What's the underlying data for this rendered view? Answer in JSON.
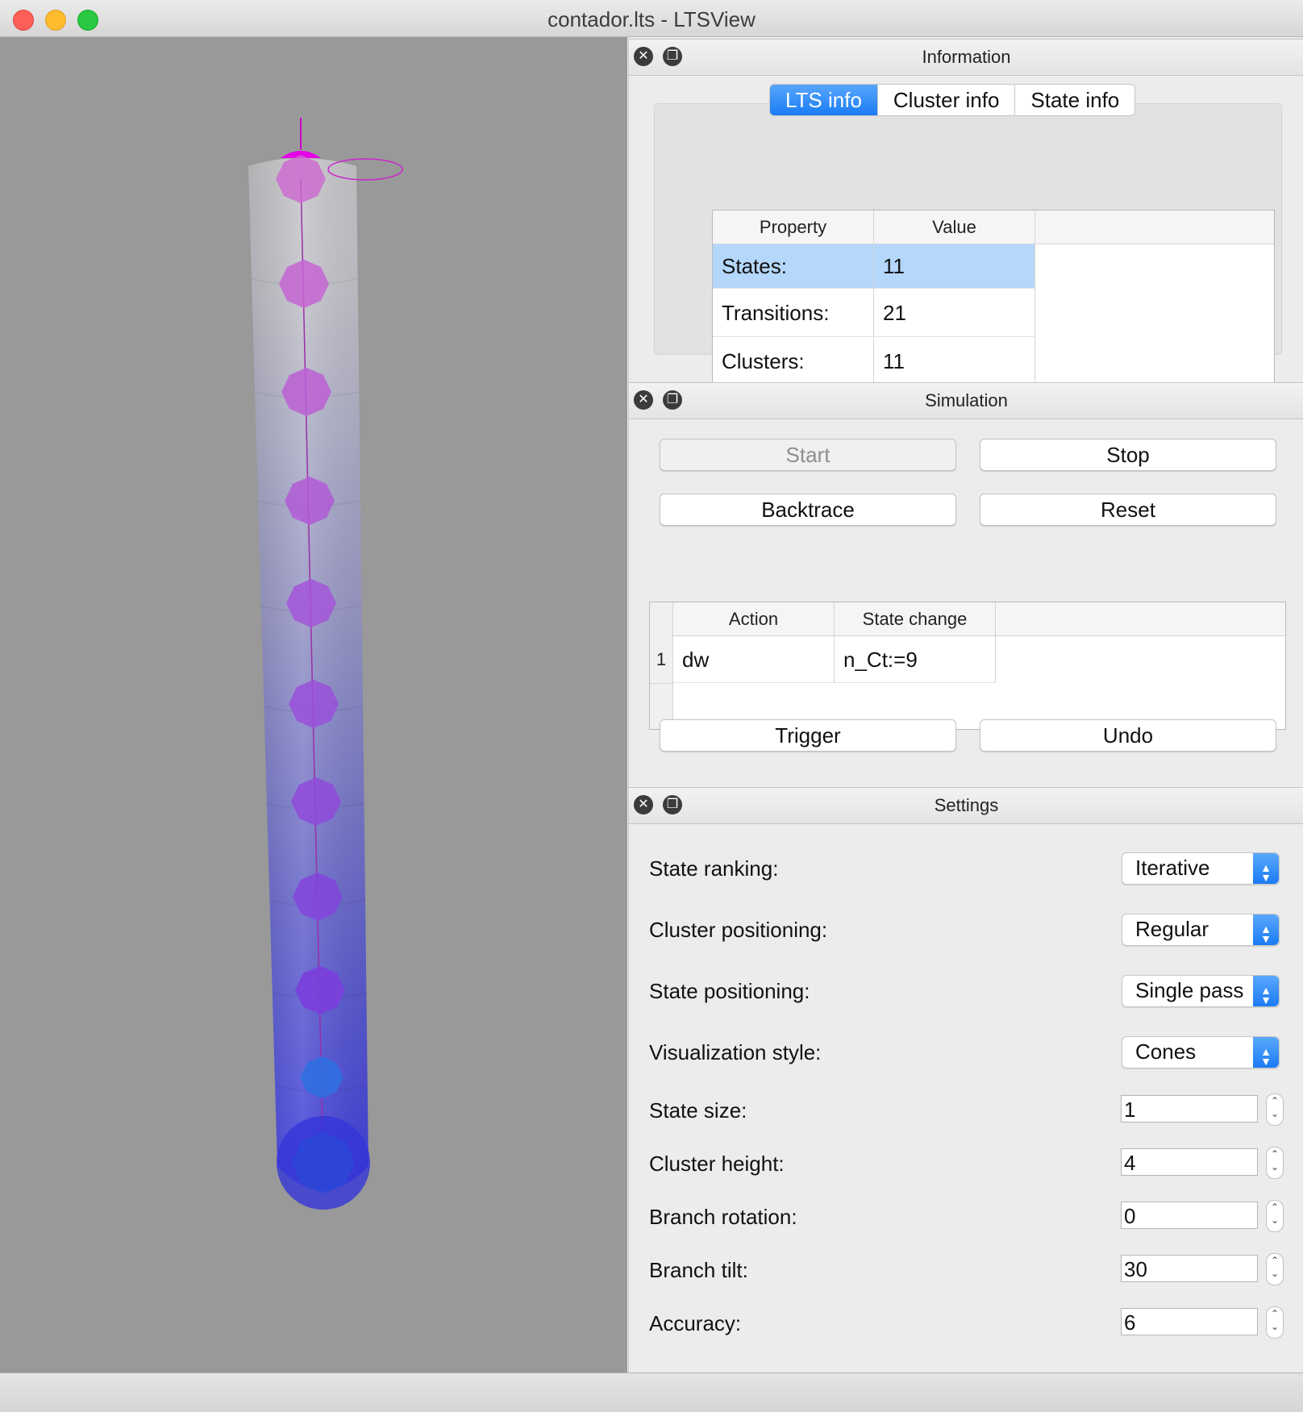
{
  "window": {
    "title": "contador.lts - LTSView"
  },
  "information": {
    "title": "Information",
    "tabs": [
      {
        "label": "LTS info",
        "active": true
      },
      {
        "label": "Cluster info",
        "active": false
      },
      {
        "label": "State info",
        "active": false
      }
    ],
    "table": {
      "headers": [
        "Property",
        "Value"
      ],
      "rows": [
        {
          "property": "States:",
          "value": "11",
          "selected": true
        },
        {
          "property": "Transitions:",
          "value": "21",
          "selected": false
        },
        {
          "property": "Clusters:",
          "value": "11",
          "selected": false
        }
      ]
    }
  },
  "simulation": {
    "title": "Simulation",
    "buttons": {
      "start": "Start",
      "stop": "Stop",
      "backtrace": "Backtrace",
      "reset": "Reset",
      "trigger": "Trigger",
      "undo": "Undo"
    },
    "table": {
      "headers": [
        "Action",
        "State change"
      ],
      "rows": [
        {
          "num": "1",
          "action": "dw",
          "state_change": "n_Ct:=9"
        }
      ]
    }
  },
  "settings": {
    "title": "Settings",
    "state_ranking": {
      "label": "State ranking:",
      "value": "Iterative"
    },
    "cluster_positioning": {
      "label": "Cluster positioning:",
      "value": "Regular"
    },
    "state_positioning": {
      "label": "State positioning:",
      "value": "Single pass"
    },
    "visualization_style": {
      "label": "Visualization style:",
      "value": "Cones"
    },
    "state_size": {
      "label": "State size:",
      "value": "1"
    },
    "cluster_height": {
      "label": "Cluster height:",
      "value": "4"
    },
    "branch_rotation": {
      "label": "Branch rotation:",
      "value": "0"
    },
    "branch_tilt": {
      "label": "Branch tilt:",
      "value": "30"
    },
    "accuracy": {
      "label": "Accuracy:",
      "value": "6"
    }
  },
  "icons": {
    "panel_close": "close-icon",
    "panel_float": "float-icon"
  },
  "colors": {
    "accent": "#1a7cf5",
    "selection": "#b4d7fb",
    "viewport_bg": "#999999",
    "initial_state": "#e600e6"
  }
}
